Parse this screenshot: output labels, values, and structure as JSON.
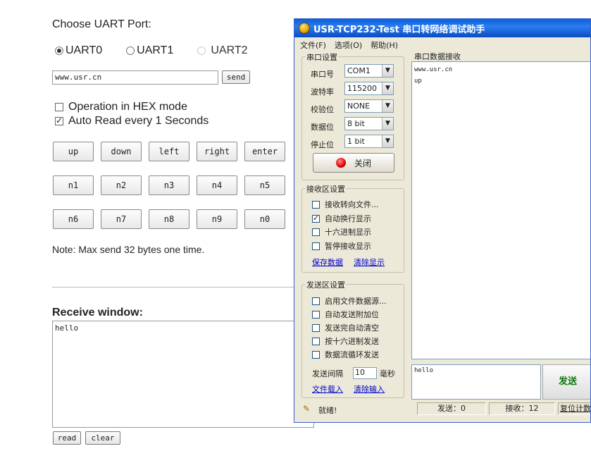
{
  "web": {
    "port_title": "Choose UART Port:",
    "radios": [
      {
        "label": "UART0",
        "selected": true,
        "disabled": false
      },
      {
        "label": "UART1",
        "selected": false,
        "disabled": false
      },
      {
        "label": "UART2",
        "selected": false,
        "disabled": true
      }
    ],
    "send_input_value": "www.usr.cn",
    "send_button": "send",
    "options": [
      {
        "label": "Operation in HEX mode",
        "checked": false
      },
      {
        "label": "Auto Read every 1 Seconds",
        "checked": true
      }
    ],
    "keys": [
      [
        "up",
        "down",
        "left",
        "right",
        "enter"
      ],
      [
        "n1",
        "n2",
        "n3",
        "n4",
        "n5"
      ],
      [
        "n6",
        "n7",
        "n8",
        "n9",
        "n0"
      ]
    ],
    "note": "Note: Max send 32 bytes one time.",
    "receive_title": "Receive window:",
    "receive_text": "hello",
    "read_button": "read",
    "clear_button": "clear"
  },
  "tool": {
    "title": "USR-TCP232-Test  串口转网络调试助手",
    "menu": [
      "文件(F)",
      "选项(O)",
      "帮助(H)"
    ],
    "serial_group": "串口设置",
    "fields": [
      {
        "label": "串口号",
        "value": "COM1"
      },
      {
        "label": "波特率",
        "value": "115200"
      },
      {
        "label": "校验位",
        "value": "NONE"
      },
      {
        "label": "数据位",
        "value": "8 bit"
      },
      {
        "label": "停止位",
        "value": "1 bit"
      }
    ],
    "close_button": "关闭",
    "recv_group": "接收区设置",
    "recv_options": [
      {
        "label": "接收转向文件...",
        "checked": false
      },
      {
        "label": "自动换行显示",
        "checked": true
      },
      {
        "label": "十六进制显示",
        "checked": false
      },
      {
        "label": "暂停接收显示",
        "checked": false
      }
    ],
    "save_data": "保存数据",
    "clear_display": "清除显示",
    "send_group": "发送区设置",
    "send_options": [
      {
        "label": "启用文件数据源...",
        "checked": false
      },
      {
        "label": "自动发送附加位",
        "checked": false
      },
      {
        "label": "发送完自动清空",
        "checked": false
      },
      {
        "label": "按十六进制发送",
        "checked": false
      },
      {
        "label": "数据流循环发送",
        "checked": false
      }
    ],
    "interval_label": "发送间隔",
    "interval_value": "10",
    "interval_unit": "毫秒",
    "load_file": "文件载入",
    "clear_input": "清除输入",
    "recv_area_title": "串口数据接收",
    "recv_lines": [
      "www.usr.cn",
      "up"
    ],
    "send_text": "hello",
    "send_button": "发送",
    "status_ready": "就绪!",
    "status_sent": "发送：0",
    "status_recv": "接收：12",
    "status_reset": "复位计数"
  }
}
